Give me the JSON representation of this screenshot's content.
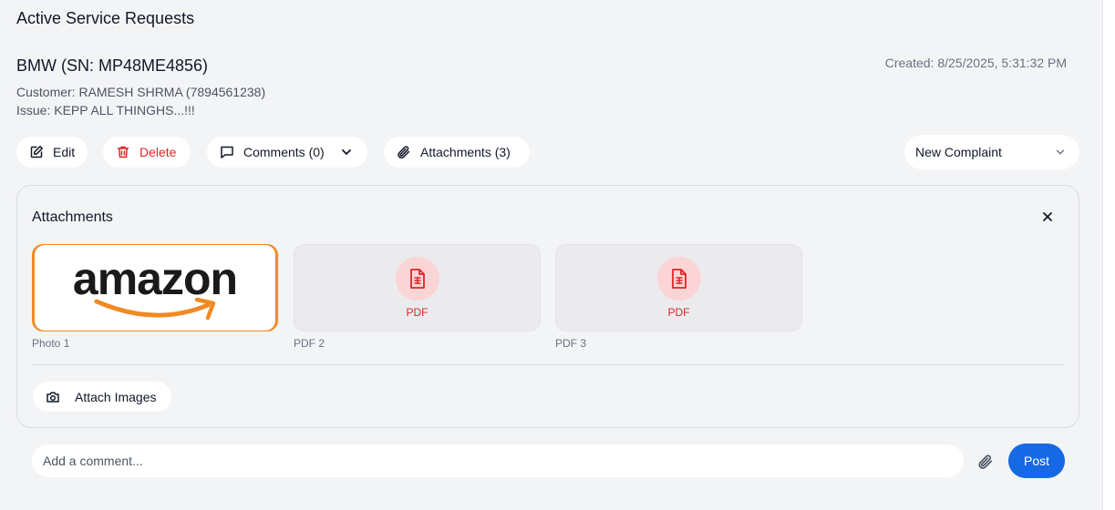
{
  "section": {
    "title": "Active Service Requests"
  },
  "request": {
    "title": "BMW (SN: MP48ME4856)",
    "created": "Created: 8/25/2025, 5:31:32 PM",
    "customer": "Customer: RAMESH SHRMA (7894561238)",
    "issue": "Issue: KEPP ALL THINGHS...!!!"
  },
  "actions": {
    "edit": "Edit",
    "delete": "Delete",
    "comments": "Comments (0)",
    "attachments": "Attachments (3)"
  },
  "status": {
    "selected": "New Complaint"
  },
  "attachments_panel": {
    "title": "Attachments",
    "items": [
      {
        "caption": "Photo 1",
        "type": "image",
        "logo_text": "amazon"
      },
      {
        "caption": "PDF 2",
        "type": "pdf",
        "label": "PDF"
      },
      {
        "caption": "PDF 3",
        "type": "pdf",
        "label": "PDF"
      }
    ],
    "attach_images_label": "Attach Images"
  },
  "comment": {
    "placeholder": "Add a comment...",
    "post_label": "Post"
  },
  "colors": {
    "accent": "#1668e3",
    "danger": "#dc2626",
    "pdf_bg": "#fbd5d5",
    "logo_orange": "#f08a24"
  },
  "icons": [
    "edit-icon",
    "trash-icon",
    "comment-icon",
    "chevron-down-icon",
    "paperclip-icon",
    "close-icon",
    "pdf-file-icon",
    "camera-icon"
  ]
}
